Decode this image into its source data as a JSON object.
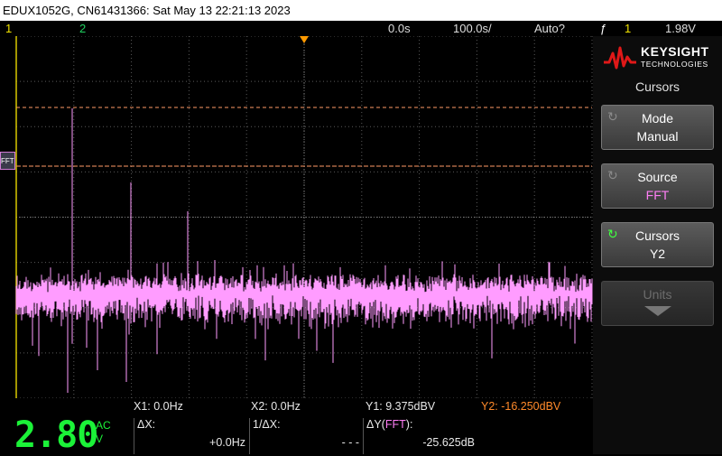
{
  "title": "EDUX1052G, CN61431366: Sat May 13 22:21:13 2023",
  "status": {
    "ch1": "1",
    "ch2": "2",
    "delay": "0.0s",
    "timebase": "100.0s/",
    "trigger_mode": "Auto?",
    "trigger_icon": "ƒ",
    "trigger_channel": "1",
    "trigger_level": "1.98V"
  },
  "screen": {
    "fft_label": "FFT",
    "trace_color": "#ff9cff",
    "cursor_color": "#ff9a66"
  },
  "cursor_readout": {
    "x1": "X1: 0.0Hz",
    "x2": "X2: 0.0Hz",
    "y1": "Y1: 9.375dBV",
    "y2": "Y2: -16.250dBV"
  },
  "measure": {
    "big_value": "2.80",
    "ac": "AC",
    "v": "V",
    "dx_label": "ΔX:",
    "dx_value": "+0.0Hz",
    "inv_dx_label": "1/ΔX:",
    "inv_dx_value": "- - -",
    "dy_label": "ΔY(",
    "dy_fft": "FFT",
    "dy_label_end": "):",
    "dy_value": "-25.625dB"
  },
  "panel": {
    "brand": "KEYSIGHT",
    "sub": "TECHNOLOGIES",
    "menu_title": "Cursors",
    "softkeys": [
      {
        "title": "Mode",
        "value": "Manual",
        "icon": "rotate-icon"
      },
      {
        "title": "Source",
        "value": "FFT",
        "icon": "rotate-icon"
      },
      {
        "title": "Cursors",
        "value": "Y2",
        "icon": "rotate-icon"
      },
      {
        "title": "Units",
        "value": "",
        "icon": "down-arrow-icon"
      }
    ]
  }
}
